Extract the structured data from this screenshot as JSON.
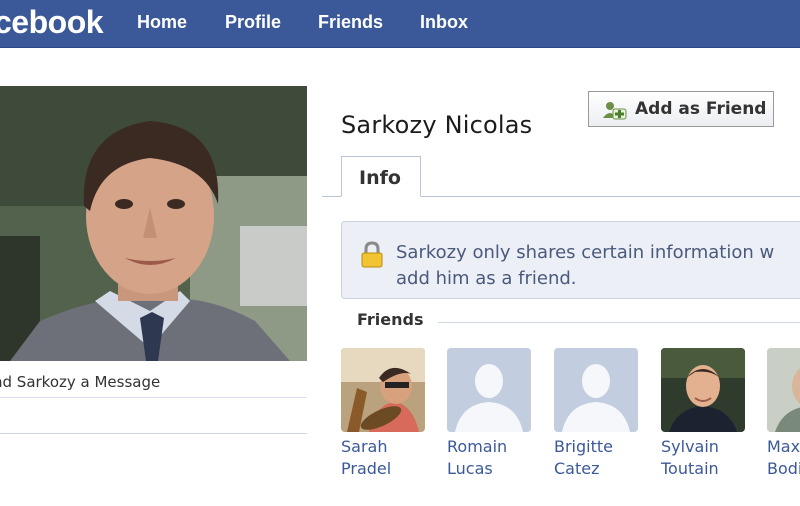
{
  "header": {
    "logo": "cebook",
    "nav": [
      "Home",
      "Profile",
      "Friends",
      "Inbox"
    ]
  },
  "sidebar": {
    "message_link": "nd Sarkozy a Message"
  },
  "profile": {
    "name": "Sarkozy Nicolas",
    "add_friend_label": "Add as Friend",
    "tab_label": "Info",
    "notice_line1": "Sarkozy only shares certain information w",
    "notice_line2": "add him as a friend."
  },
  "friends": {
    "title": "Friends",
    "items": [
      {
        "first": "Sarah",
        "last": "Pradel",
        "photo": "photo"
      },
      {
        "first": "Romain",
        "last": "Lucas",
        "photo": "silhouette"
      },
      {
        "first": "Brigitte",
        "last": "Catez",
        "photo": "silhouette"
      },
      {
        "first": "Sylvain",
        "last": "Toutain",
        "photo": "photo"
      },
      {
        "first": "Max",
        "last": "Bodi",
        "photo": "photo"
      }
    ]
  },
  "colors": {
    "brand": "#3b5998",
    "link": "#3b5998",
    "notice_bg": "#eceff5"
  }
}
